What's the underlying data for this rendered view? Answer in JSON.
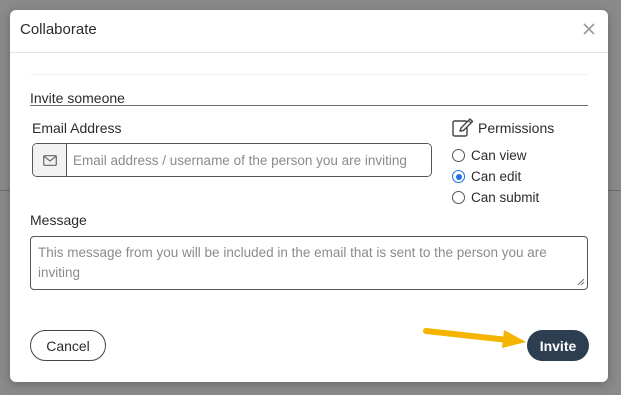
{
  "modal": {
    "title": "Collaborate",
    "close_icon": "close-icon"
  },
  "invite": {
    "section_title": "Invite someone",
    "email": {
      "label": "Email Address",
      "placeholder": "Email address / username of the person you are inviting",
      "value": "",
      "icon": "envelope-icon"
    },
    "permissions": {
      "title": "Permissions",
      "icon": "edit-icon",
      "options": [
        {
          "label": "Can view",
          "checked": false
        },
        {
          "label": "Can edit",
          "checked": true
        },
        {
          "label": "Can submit",
          "checked": false
        }
      ]
    },
    "message": {
      "label": "Message",
      "placeholder": "This message from you will be included in the email that is sent to the person you are inviting",
      "value": ""
    }
  },
  "actions": {
    "cancel_label": "Cancel",
    "invite_label": "Invite"
  },
  "annotation": {
    "arrow_icon": "arrow-right-icon",
    "arrow_color": "#f5b400"
  },
  "colors": {
    "invite_button": "#2c3e50",
    "radio_accent": "#1a73e8",
    "backdrop": "#8a8a8a"
  }
}
